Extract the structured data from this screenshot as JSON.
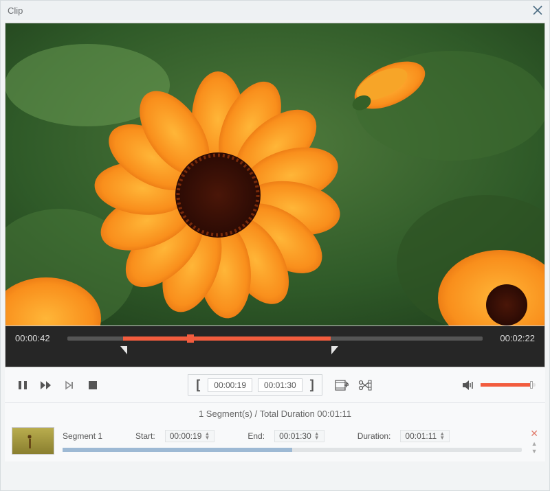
{
  "window": {
    "title": "Clip"
  },
  "timeline": {
    "current_time": "00:00:42",
    "total_time": "00:02:22",
    "selection_start_pct": 13.4,
    "selection_end_pct": 63.4,
    "playhead_pct": 29.6
  },
  "controls": {
    "clip_in_time": "00:00:19",
    "clip_out_time": "00:01:30",
    "volume_pct": 90,
    "icons": {
      "pause": "pause-icon",
      "fast_forward": "fast-forward-icon",
      "next_frame": "next-frame-icon",
      "stop": "stop-icon",
      "bracket_open": "bracket-open-icon",
      "bracket_close": "bracket-close-icon",
      "add_segment": "add-segment-icon",
      "cut": "cut-icon",
      "volume": "volume-icon"
    }
  },
  "summary": {
    "text": "1 Segment(s) / Total Duration 00:01:11",
    "segment_count": 1,
    "total_duration": "00:01:11"
  },
  "segments": [
    {
      "name_label": "Segment 1",
      "start_label": "Start:",
      "start": "00:00:19",
      "end_label": "End:",
      "end": "00:01:30",
      "duration_label": "Duration:",
      "duration": "00:01:11",
      "progress_pct": 50
    }
  ],
  "colors": {
    "accent": "#f25c3e",
    "timeline_bg": "#262626",
    "panel_bg": "#f8f9fa"
  }
}
